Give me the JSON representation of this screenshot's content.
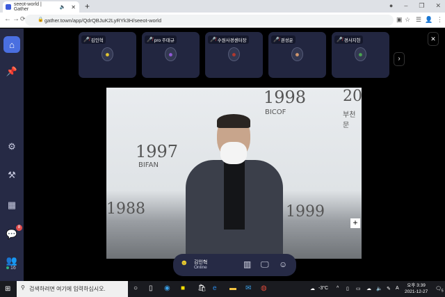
{
  "browser": {
    "tab_title": "seeot-world | Gather",
    "url": "gather.town/app/QdrQBJuK2LyRYk3H/seeot-world"
  },
  "sidebar": {
    "chat_badge": "8",
    "online_count": "16"
  },
  "participants": [
    {
      "name": "김인혁",
      "avatar_color": "#f2d22e"
    },
    {
      "name": "pro 주태규",
      "avatar_color": "#9b5de5"
    },
    {
      "name": "수원사경센터장",
      "avatar_color": "#c0392b"
    },
    {
      "name": "권성운",
      "avatar_color": "#e0a070"
    },
    {
      "name": "경사지헌",
      "avatar_color": "#4caf50"
    }
  ],
  "video": {
    "bg_text": [
      "1997",
      "BIFAN",
      "1998",
      "BICOF",
      "20",
      "부천문",
      "1988",
      "1999"
    ]
  },
  "bottom_bar": {
    "name": "김인혁",
    "status": "Online"
  },
  "taskbar": {
    "search_placeholder": "검색하려면 여기에 입력하십시오.",
    "weather": "-3°C",
    "time": "오후 3:39",
    "date": "2021-12-27",
    "notifications": "5",
    "ime": "A"
  },
  "colors": {
    "sidebar": "#262a45",
    "accent": "#4a6fe0",
    "online": "#2fb380"
  }
}
